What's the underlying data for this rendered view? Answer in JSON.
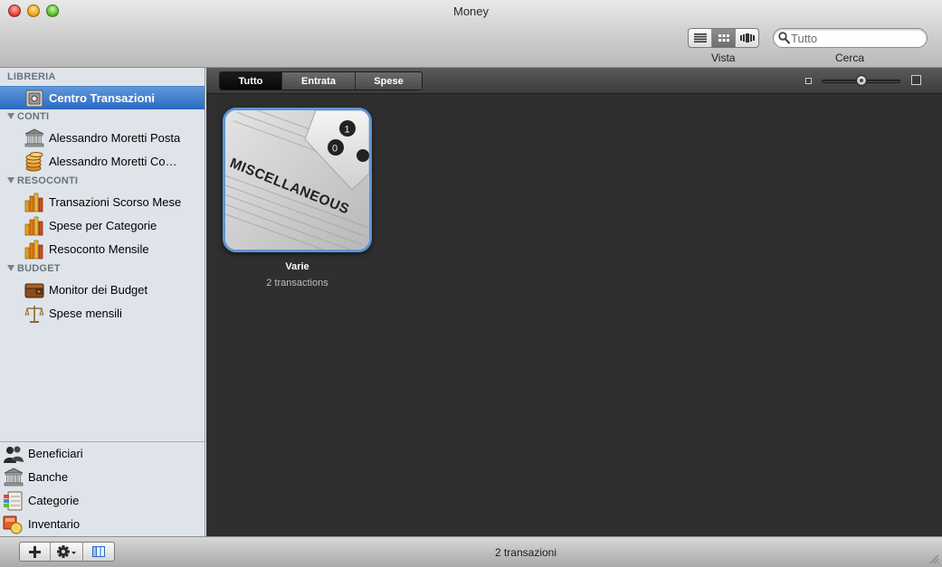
{
  "window": {
    "title": "Money"
  },
  "toolbar": {
    "view_label": "Vista",
    "search_label": "Cerca",
    "search_placeholder": "Tutto",
    "view_modes": [
      "list-view-icon",
      "grid-view-icon",
      "coverflow-view-icon"
    ],
    "active_view": "grid-view-icon"
  },
  "sidebar": {
    "library_header": "LIBRERIA",
    "library_items": [
      {
        "label": "Centro Transazioni",
        "icon": "safe-icon",
        "selected": true
      }
    ],
    "accounts_header": "CONTI",
    "accounts": [
      {
        "label": "Alessandro Moretti Posta",
        "icon": "bank-icon"
      },
      {
        "label": "Alessandro Moretti Co…",
        "icon": "coins-icon"
      }
    ],
    "reports_header": "RESOCONTI",
    "reports": [
      {
        "label": "Transazioni Scorso Mese",
        "icon": "bar-chart-icon"
      },
      {
        "label": "Spese per Categorie",
        "icon": "bar-chart-icon"
      },
      {
        "label": "Resoconto Mensile",
        "icon": "bar-chart-icon"
      }
    ],
    "budget_header": "BUDGET",
    "budget": [
      {
        "label": "Monitor dei Budget",
        "icon": "wallet-icon"
      },
      {
        "label": "Spese mensili",
        "icon": "scales-icon"
      }
    ],
    "bottom_items": [
      {
        "label": "Beneficiari",
        "icon": "people-icon"
      },
      {
        "label": "Banche",
        "icon": "bank-icon"
      },
      {
        "label": "Categorie",
        "icon": "categories-icon"
      },
      {
        "label": "Inventario",
        "icon": "inventory-icon"
      }
    ]
  },
  "main": {
    "filters": [
      "Tutto",
      "Entrata",
      "Spese"
    ],
    "active_filter": "Tutto",
    "zoom_level": 0.5,
    "cards": [
      {
        "name": "Varie",
        "subtitle": "2 transactions",
        "image_text": "MISCELLANEOUS"
      }
    ]
  },
  "status_bar": {
    "text": "2 transazioni"
  },
  "colors": {
    "selection": "#2a6ac4",
    "card_border": "#5c95d9",
    "content_bg": "#2f2f2f",
    "sidebar_bg": "#dfe4ea"
  }
}
